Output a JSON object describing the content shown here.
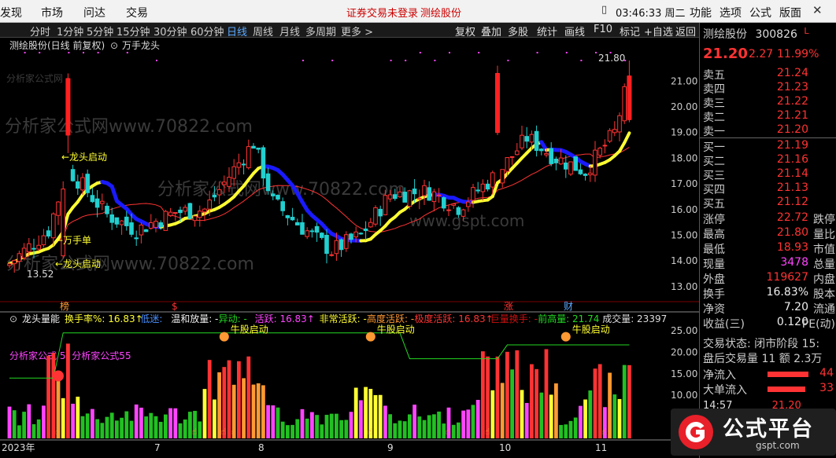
{
  "menu": {
    "items": [
      "发现",
      "市场",
      "问达",
      "交易"
    ],
    "notice1": "证券交易未登录",
    "notice2": "测绘股份",
    "clock": "03:46:33 周二",
    "right": [
      "功能",
      "选项",
      "公式",
      "版面"
    ]
  },
  "toolbar": {
    "periods": [
      "分时",
      "1分钟",
      "5分钟",
      "15分钟",
      "30分钟",
      "60分钟",
      "日线",
      "周线",
      "月线",
      "多周期",
      "更多 >"
    ],
    "active": "日线",
    "tools": [
      "复权",
      "叠加",
      "多股",
      "统计",
      "画线",
      "F10",
      "标记",
      "+自选",
      "返回"
    ]
  },
  "stock": {
    "name": "测绘股份",
    "code": "300826",
    "tag": "L",
    "title": "测绘股份(日线 前复权)",
    "indicator_main": "万手龙头",
    "price": "21.20",
    "change": "2.27",
    "pct": "11.99%",
    "asks": [
      [
        "卖五",
        "21.24"
      ],
      [
        "卖四",
        "21.23"
      ],
      [
        "卖三",
        "21.22"
      ],
      [
        "卖二",
        "21.21"
      ],
      [
        "卖一",
        "21.20"
      ]
    ],
    "bids": [
      [
        "买一",
        "21.19"
      ],
      [
        "买二",
        "21.16"
      ],
      [
        "买三",
        "21.14"
      ],
      [
        "买四",
        "21.13"
      ],
      [
        "买五",
        "21.12"
      ]
    ],
    "stats": [
      [
        "涨停",
        "22.72",
        "跌停"
      ],
      [
        "最高",
        "21.80",
        "量比"
      ],
      [
        "最低",
        "18.93",
        "市值"
      ],
      [
        "现量",
        "3478",
        "总量"
      ],
      [
        "外盘",
        "119627",
        "内盘"
      ],
      [
        "换手",
        "16.83%",
        "股本"
      ],
      [
        "净资",
        "7.20",
        "流通"
      ],
      [
        "收益(三)",
        "0.120",
        "PE(动)"
      ]
    ],
    "trade_status": "交易状态: 闭市阶段 15:",
    "after": "盘后交易量 11 额 2.3万",
    "inflow": [
      [
        "净流入",
        "44"
      ],
      [
        "大单流入",
        "33"
      ]
    ],
    "time_row": [
      "14:57",
      "21.20"
    ]
  },
  "watermarks": [
    "分析家公式网",
    "分析家公式网www.70822.com",
    "分析家公式网www.70822.com",
    "分析家公式网www.70822.com",
    "www.gspt.com"
  ],
  "annotations": {
    "high": "21.80",
    "low": "13.52",
    "dragon1": "←龙头启动",
    "wan": "←万手单",
    "dragon2": "←龙头启动"
  },
  "sub": {
    "title": "龙头量能",
    "items": [
      [
        "换手率%: 16.83↑",
        "#ffff33"
      ],
      [
        "低迷: ",
        "#4a90ff"
      ],
      [
        "温和放量: -",
        "#eeeeee"
      ],
      [
        "异动: -",
        "#22d822"
      ],
      [
        "活跃: 16.83↑",
        "#ff44ff"
      ],
      [
        "非常活跃: -",
        "#ffff33"
      ],
      [
        "高度活跃: -",
        "#ff9933"
      ],
      [
        "极度活跃: 16.83↑",
        "#ff3333"
      ],
      [
        "巨量换手: -",
        "#cc1111"
      ],
      [
        "前高量: 21.74",
        "#22d822"
      ],
      [
        "成交量: 23397",
        "#dddddd"
      ]
    ],
    "legend": "分析家公式 5: 分析家公式55",
    "labels": [
      "牛股启动",
      "牛股启动",
      "牛股启动"
    ],
    "months": [
      "2023年",
      "7",
      "8",
      "9",
      "10",
      "11"
    ],
    "top_tags": [
      "榜",
      "$",
      "涨",
      "财"
    ]
  },
  "chart_data": {
    "type": "candlestick",
    "price_ticks": [
      "21.00",
      "20.00",
      "19.00",
      "18.00",
      "17.00",
      "16.00",
      "15.00",
      "14.00",
      "13.00"
    ],
    "ylim": [
      12.6,
      22.2
    ],
    "vol_ticks": [
      "25.00",
      "20.00",
      "15.00",
      "10.00",
      "5.00"
    ],
    "vol_ylim": [
      0,
      27
    ]
  },
  "logo": {
    "text": "公式平台",
    "sub": "gspt.com"
  },
  "colors": {
    "up": "#ff3333",
    "down": "#22d0d0",
    "ma_up": "#ffff33",
    "ma_down": "#1a1aff",
    "ma_red": "#ff3333"
  }
}
